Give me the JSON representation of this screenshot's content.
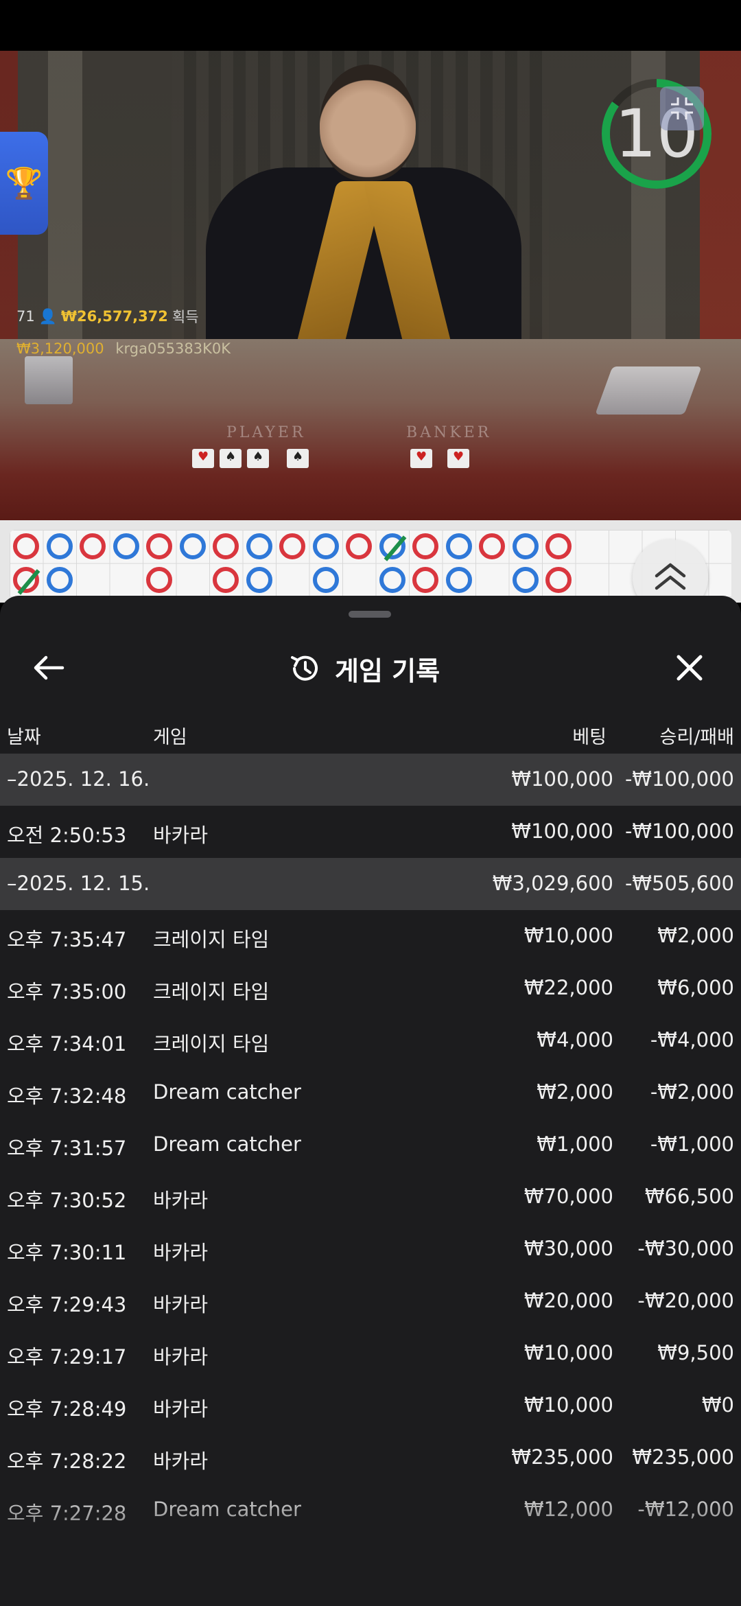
{
  "video": {
    "player_label": "PLAYER",
    "banker_label": "BANKER",
    "timer": "10",
    "overlay": {
      "count": "71",
      "amount": "₩26,577,372",
      "gain_label": "획득",
      "win_amount": "₩3,120,000",
      "username": "krga055383K0K"
    }
  },
  "colors": {
    "banker_red": "#d9363e",
    "player_blue": "#2f78d8",
    "tie_green": "#1d8f4a",
    "timer_green": "#1aa34a",
    "sheet_bg": "#1c1c1e",
    "group_row_bg": "#3a3a3c"
  },
  "icons": {
    "trophy": "trophy-icon",
    "back": "arrow-left-icon",
    "history": "history-icon",
    "close": "close-icon",
    "collapse": "collapse-icon",
    "scroll_up": "chevron-up-double-icon"
  },
  "bead_road": {
    "row1": [
      "B",
      "P",
      "B",
      "P",
      "B",
      "P",
      "B",
      "P",
      "B",
      "P",
      "B",
      "P-tie",
      "B",
      "P",
      "B",
      "P",
      "B"
    ],
    "row2": [
      "B-tie",
      "P",
      "",
      "",
      "B",
      "",
      "B",
      "P",
      "",
      "P",
      "",
      "P",
      "B",
      "P",
      "",
      "P",
      "B"
    ]
  },
  "history": {
    "title": "게임 기록",
    "columns": {
      "date": "날짜",
      "game": "게임",
      "bet": "베팅",
      "result": "승리/패배"
    },
    "rows": [
      {
        "type": "group",
        "date": "–2025. 12. 16.",
        "game": "",
        "bet": "₩100,000",
        "result": "-₩100,000"
      },
      {
        "type": "item",
        "date": "오전 2:50:53",
        "game": "바카라",
        "bet": "₩100,000",
        "result": "-₩100,000"
      },
      {
        "type": "group",
        "date": "–2025. 12. 15.",
        "game": "",
        "bet": "₩3,029,600",
        "result": "-₩505,600"
      },
      {
        "type": "item",
        "date": "오후 7:35:47",
        "game": "크레이지 타임",
        "bet": "₩10,000",
        "result": "₩2,000"
      },
      {
        "type": "item",
        "date": "오후 7:35:00",
        "game": "크레이지 타임",
        "bet": "₩22,000",
        "result": "₩6,000"
      },
      {
        "type": "item",
        "date": "오후 7:34:01",
        "game": "크레이지 타임",
        "bet": "₩4,000",
        "result": "-₩4,000"
      },
      {
        "type": "item",
        "date": "오후 7:32:48",
        "game": "Dream catcher",
        "bet": "₩2,000",
        "result": "-₩2,000"
      },
      {
        "type": "item",
        "date": "오후 7:31:57",
        "game": "Dream catcher",
        "bet": "₩1,000",
        "result": "-₩1,000"
      },
      {
        "type": "item",
        "date": "오후 7:30:52",
        "game": "바카라",
        "bet": "₩70,000",
        "result": "₩66,500"
      },
      {
        "type": "item",
        "date": "오후 7:30:11",
        "game": "바카라",
        "bet": "₩30,000",
        "result": "-₩30,000"
      },
      {
        "type": "item",
        "date": "오후 7:29:43",
        "game": "바카라",
        "bet": "₩20,000",
        "result": "-₩20,000"
      },
      {
        "type": "item",
        "date": "오후 7:29:17",
        "game": "바카라",
        "bet": "₩10,000",
        "result": "₩9,500"
      },
      {
        "type": "item",
        "date": "오후 7:28:49",
        "game": "바카라",
        "bet": "₩10,000",
        "result": "₩0"
      },
      {
        "type": "item",
        "date": "오후 7:28:22",
        "game": "바카라",
        "bet": "₩235,000",
        "result": "₩235,000"
      },
      {
        "type": "item",
        "date": "오후 7:27:28",
        "game": "Dream catcher",
        "bet": "₩12,000",
        "result": "-₩12,000"
      }
    ]
  }
}
